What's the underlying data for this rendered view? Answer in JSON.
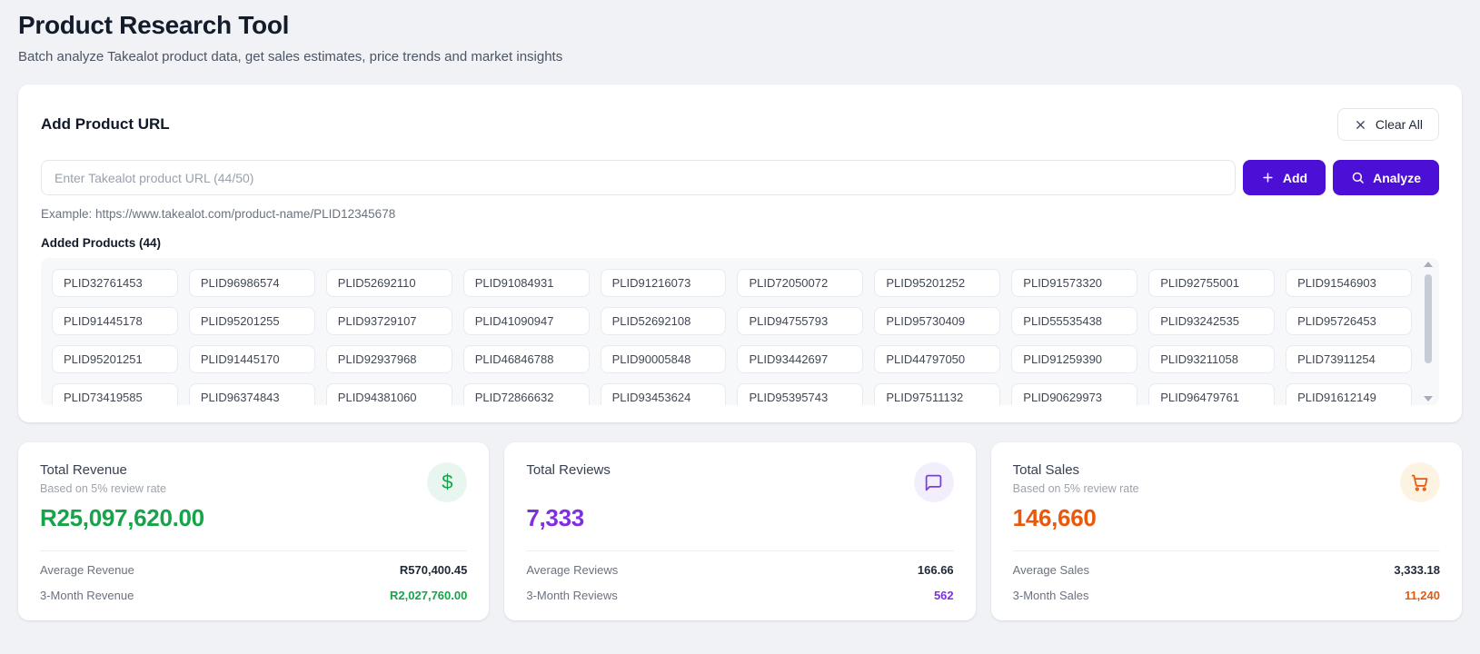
{
  "page": {
    "title": "Product Research Tool",
    "subtitle": "Batch analyze Takealot product data, get sales estimates, price trends and market insights"
  },
  "add_product": {
    "title": "Add Product URL",
    "clear_all_label": "Clear All",
    "input_placeholder": "Enter Takealot product URL (44/50)",
    "add_label": "Add",
    "analyze_label": "Analyze",
    "example": "Example: https://www.takealot.com/product-name/PLID12345678",
    "added_products_label": "Added Products (44)",
    "added_count": 44,
    "products": [
      "PLID32761453",
      "PLID96986574",
      "PLID52692110",
      "PLID91084931",
      "PLID91216073",
      "PLID72050072",
      "PLID95201252",
      "PLID91573320",
      "PLID92755001",
      "PLID91546903",
      "PLID91445178",
      "PLID95201255",
      "PLID93729107",
      "PLID41090947",
      "PLID52692108",
      "PLID94755793",
      "PLID95730409",
      "PLID55535438",
      "PLID93242535",
      "PLID95726453",
      "PLID95201251",
      "PLID91445170",
      "PLID92937968",
      "PLID46846788",
      "PLID90005848",
      "PLID93442697",
      "PLID44797050",
      "PLID91259390",
      "PLID93211058",
      "PLID73911254",
      "PLID73419585",
      "PLID96374843",
      "PLID94381060",
      "PLID72866632",
      "PLID93453624",
      "PLID95395743",
      "PLID97511132",
      "PLID90629973",
      "PLID96479761",
      "PLID91612149"
    ]
  },
  "stats": {
    "revenue": {
      "title": "Total Revenue",
      "subtitle": "Based on 5% review rate",
      "value": "R25,097,620.00",
      "icon": "dollar-icon",
      "average_label": "Average Revenue",
      "average_value": "R570,400.45",
      "three_month_label": "3-Month Revenue",
      "three_month_value": "R2,027,760.00"
    },
    "reviews": {
      "title": "Total Reviews",
      "subtitle": "",
      "value": "7,333",
      "icon": "message-icon",
      "average_label": "Average Reviews",
      "average_value": "166.66",
      "three_month_label": "3-Month Reviews",
      "three_month_value": "562"
    },
    "sales": {
      "title": "Total Sales",
      "subtitle": "Based on 5% review rate",
      "value": "146,660",
      "icon": "cart-icon",
      "average_label": "Average Sales",
      "average_value": "3,333.18",
      "three_month_label": "3-Month Sales",
      "three_month_value": "11,240"
    }
  },
  "colors": {
    "primary_button": "#4c0fd6",
    "revenue_accent": "#16a34a",
    "reviews_accent": "#7f2fe0",
    "sales_accent": "#ea580c",
    "page_background": "#f0f2f6"
  }
}
